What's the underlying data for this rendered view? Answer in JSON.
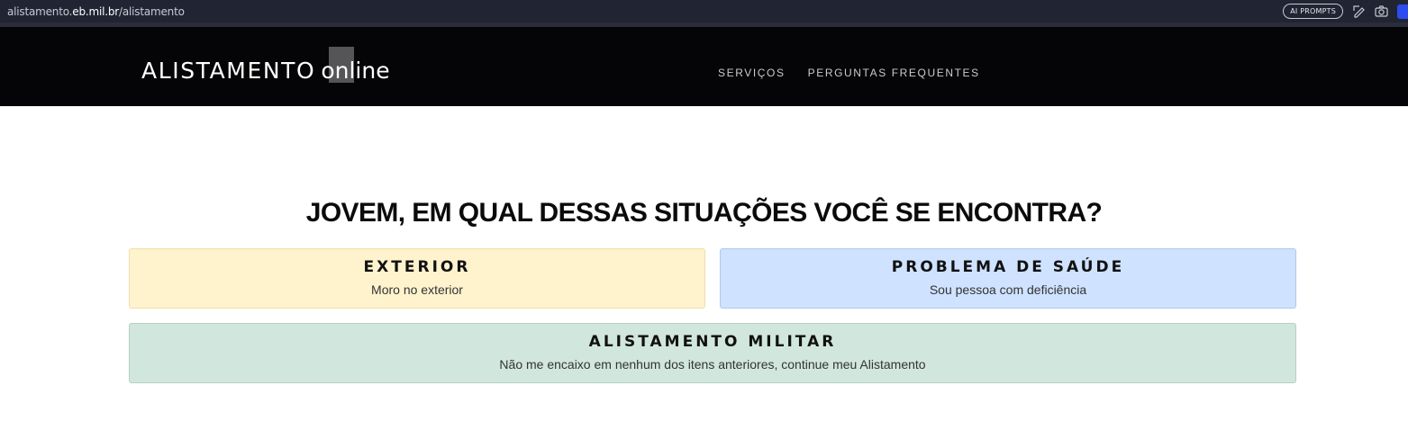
{
  "browser": {
    "url_prefix": "alistamento.",
    "url_host": "eb.mil.br",
    "url_path": "/alistamento",
    "ai_prompts_label": "AI PROMPTS",
    "icons": [
      "edit-icon",
      "camera-icon",
      "extension-icon"
    ]
  },
  "navbar": {
    "brand_main": "ALISTAMENTO",
    "brand_online": "online",
    "links": [
      {
        "label": "SERVIÇOS"
      },
      {
        "label": "PERGUNTAS FREQUENTES"
      }
    ]
  },
  "main": {
    "headline": "JOVEM, EM QUAL DESSAS SITUAÇÕES VOCÊ SE ENCONTRA?",
    "cards": [
      {
        "title": "EXTERIOR",
        "subtitle": "Moro no exterior",
        "color": "#fff3cd"
      },
      {
        "title": "PROBLEMA DE SAÚDE",
        "subtitle": "Sou pessoa com deficiência",
        "color": "#cfe2ff"
      },
      {
        "title": "ALISTAMENTO MILITAR",
        "subtitle": "Não me encaixo em nenhum dos itens anteriores, continue meu Alistamento",
        "color": "#d1e7dd"
      }
    ]
  },
  "colors": {
    "browser_bar": "#202433",
    "navbar_bg": "#050507",
    "nav_link": "#c9cad0",
    "extension_accent": "#2d4cf0"
  }
}
